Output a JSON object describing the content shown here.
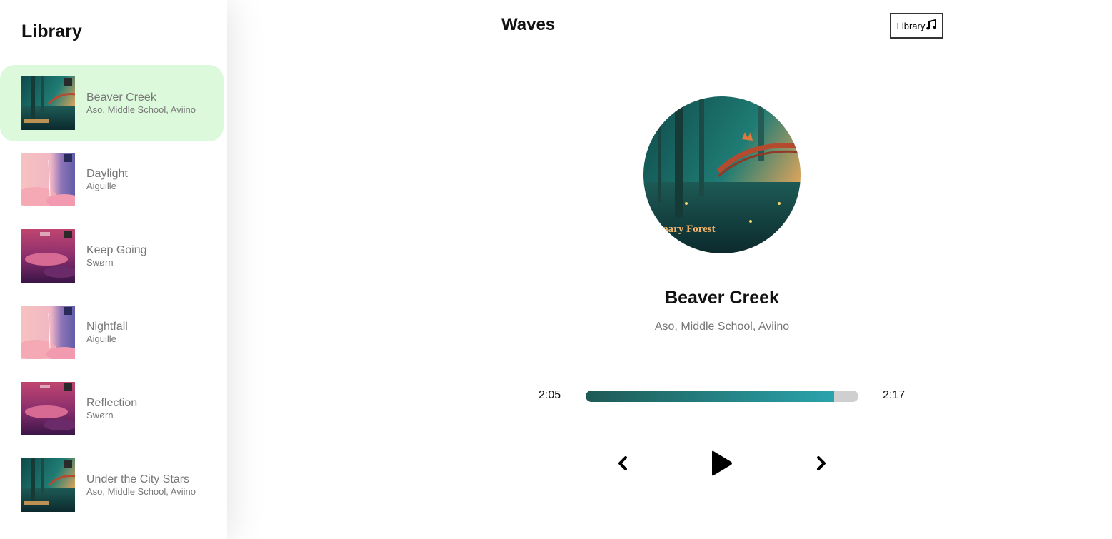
{
  "sidebar": {
    "title": "Library",
    "songs": [
      {
        "name": "Beaver Creek",
        "artist": "Aso, Middle School, Aviino",
        "art": "forest",
        "selected": true
      },
      {
        "name": "Daylight",
        "artist": "Aiguille",
        "art": "pink-sky",
        "selected": false
      },
      {
        "name": "Keep Going",
        "artist": "Swørn",
        "art": "magenta",
        "selected": false
      },
      {
        "name": "Nightfall",
        "artist": "Aiguille",
        "art": "pink-sky",
        "selected": false
      },
      {
        "name": "Reflection",
        "artist": "Swørn",
        "art": "magenta",
        "selected": false
      },
      {
        "name": "Under the City Stars",
        "artist": "Aso, Middle School, Aviino",
        "art": "forest",
        "selected": false
      }
    ]
  },
  "nav": {
    "title": "Waves",
    "library_button": "Library",
    "library_icon": "music-note-icon"
  },
  "player": {
    "track_name": "Beaver Creek",
    "track_artist": "Aso, Middle School, Aviino",
    "cover_text": "Canary Forest",
    "current_time": "2:05",
    "total_time": "2:17",
    "progress": 0.912,
    "prev_icon": "chevron-left-icon",
    "play_icon": "play-icon",
    "next_icon": "chevron-right-icon"
  },
  "colors": {
    "selected_bg": "#dcf9db",
    "progress_start": "#1e5a55",
    "progress_end": "#2aa3ac",
    "track_bg": "#cfcfcf"
  }
}
